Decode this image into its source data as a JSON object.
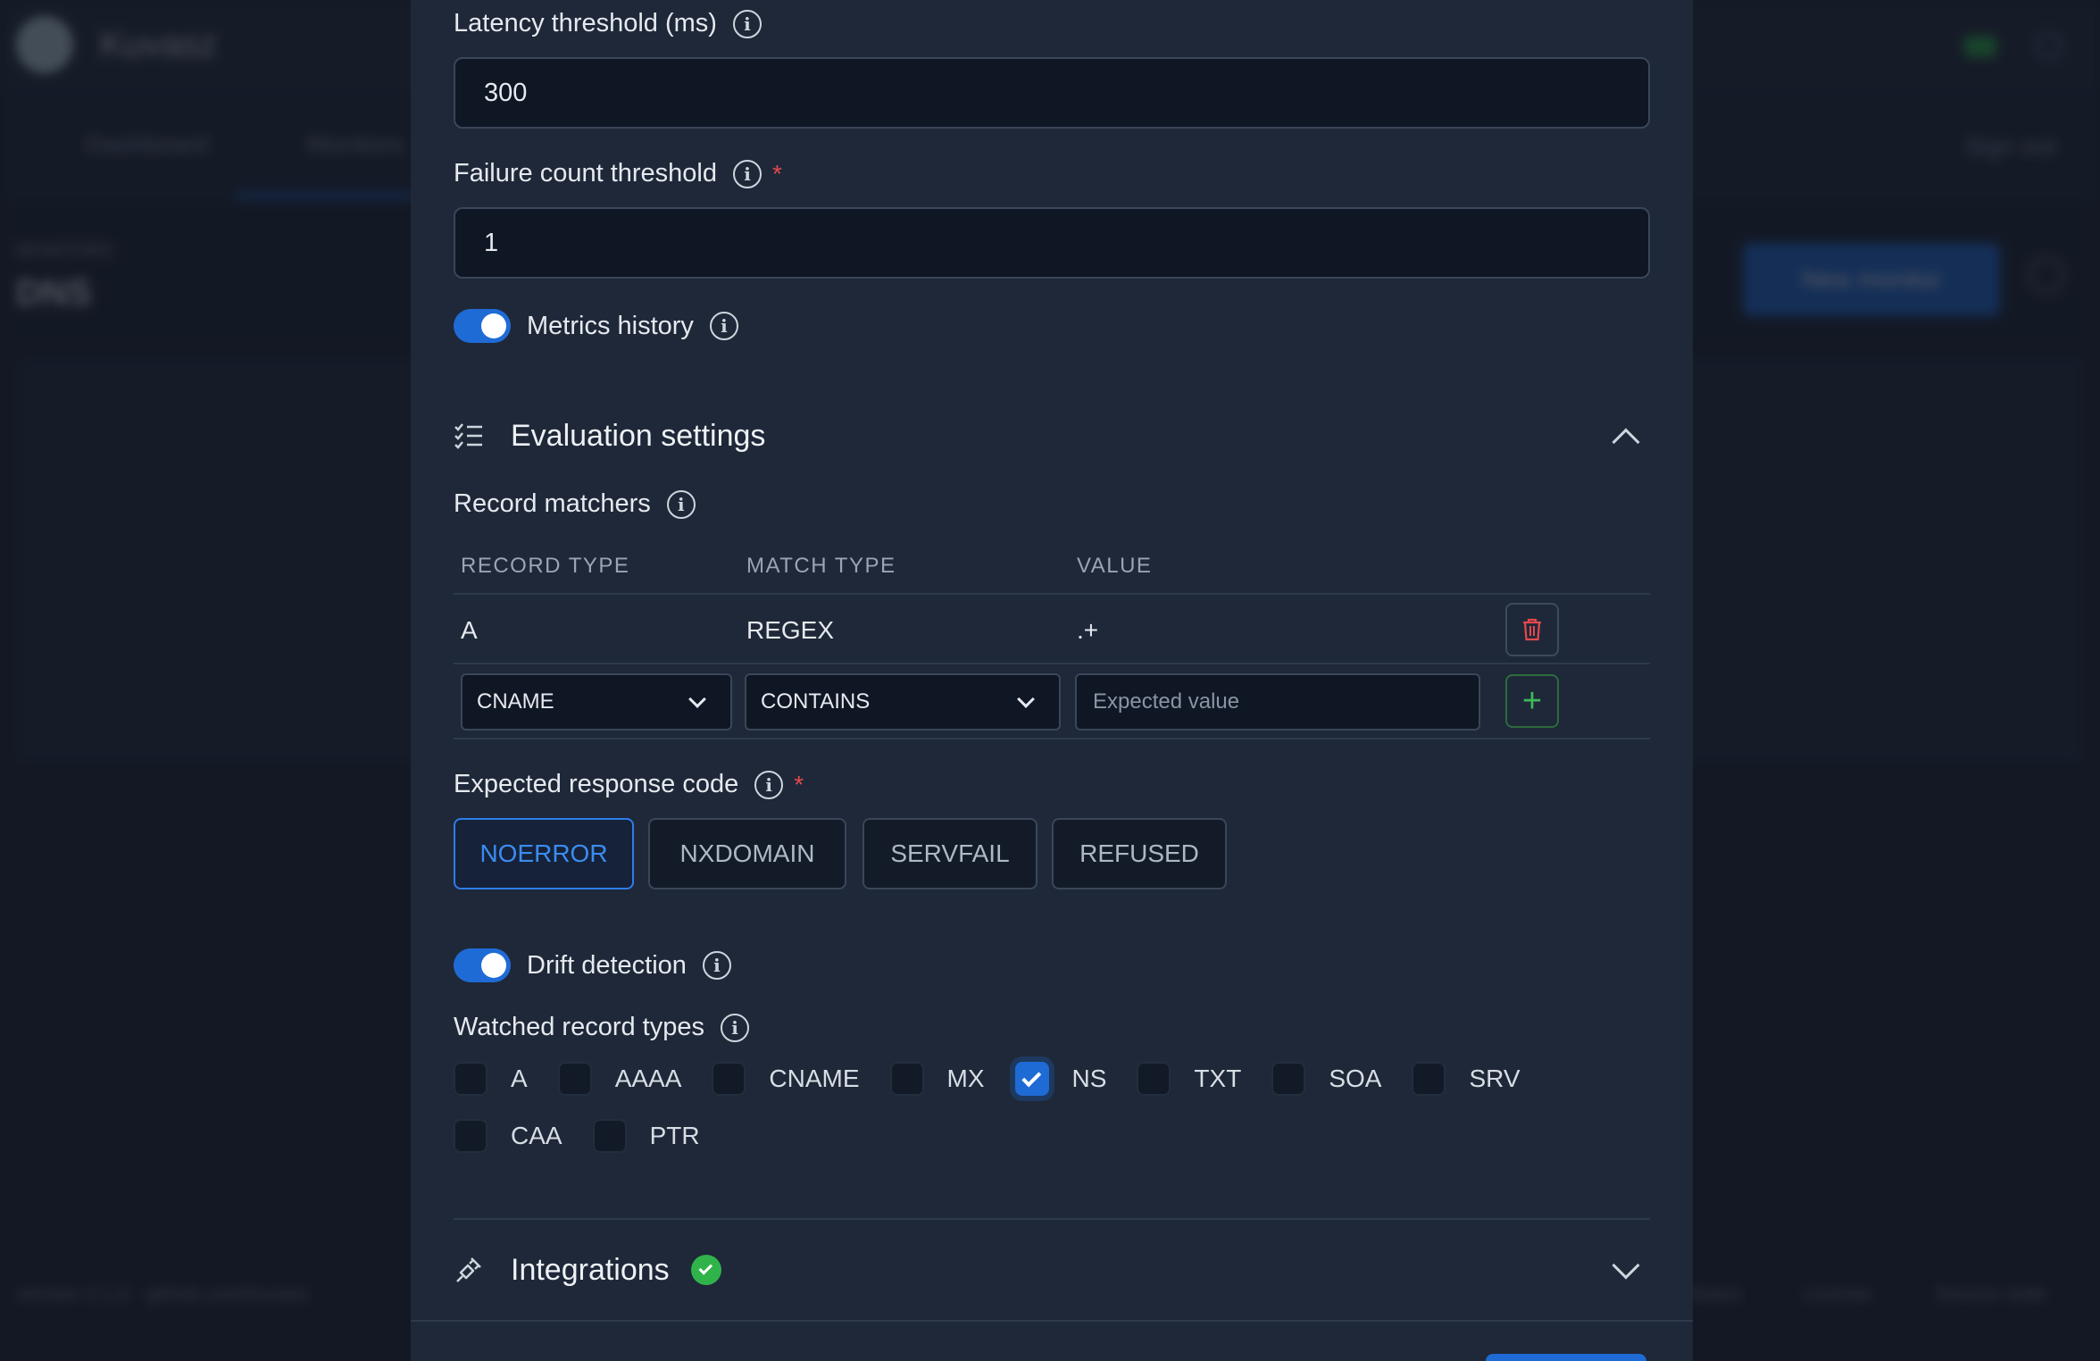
{
  "background": {
    "app_name": "Kuvasz",
    "nav": [
      "Dashboard",
      "Monitors"
    ],
    "sign_out": "Sign out",
    "breadcrumb": "MONITORS",
    "page_title": "DNS",
    "new_button": "New monitor",
    "footer_left": "version 2.1.0 · github.com/kuvasz",
    "footer_links": [
      "Status",
      "License",
      "Source code"
    ]
  },
  "latency": {
    "label": "Latency threshold (ms)",
    "value": "300"
  },
  "failure": {
    "label": "Failure count threshold",
    "required_mark": "*",
    "value": "1"
  },
  "metrics_history": {
    "label": "Metrics history",
    "enabled": true
  },
  "evaluation": {
    "title": "Evaluation settings",
    "record_matchers": {
      "label": "Record matchers",
      "columns": [
        "RECORD TYPE",
        "MATCH TYPE",
        "VALUE"
      ],
      "rows": [
        {
          "record_type": "A",
          "match_type": "REGEX",
          "value": ".+"
        }
      ],
      "new_row": {
        "record_type": "CNAME",
        "match_type": "CONTAINS",
        "value_placeholder": "Expected value"
      }
    },
    "response_code": {
      "label": "Expected response code",
      "required_mark": "*",
      "options": [
        "NOERROR",
        "NXDOMAIN",
        "SERVFAIL",
        "REFUSED"
      ],
      "selected": "NOERROR"
    },
    "drift_detection": {
      "label": "Drift detection",
      "enabled": true
    },
    "watched": {
      "label": "Watched record types",
      "types": [
        "A",
        "AAAA",
        "CNAME",
        "MX",
        "NS",
        "TXT",
        "SOA",
        "SRV",
        "CAA",
        "PTR"
      ],
      "checked": [
        "NS"
      ]
    }
  },
  "integrations": {
    "title": "Integrations",
    "status": "ok"
  },
  "colors": {
    "accent": "#1f6bd6",
    "success": "#2fb34a",
    "danger": "#e5484d",
    "panel": "#1e2838"
  }
}
